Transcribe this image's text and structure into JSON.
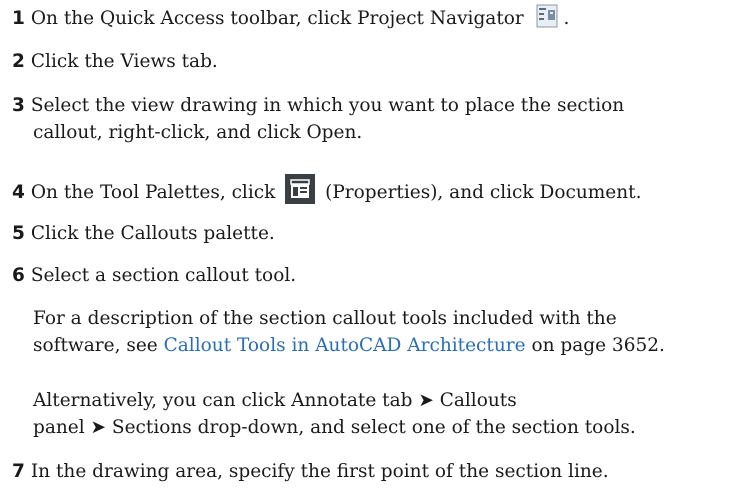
{
  "steps": [
    {
      "num": "1",
      "text_before": "On the Quick Access toolbar, click Project Navigator",
      "text_after": "."
    },
    {
      "num": "2",
      "text": "Click the Views tab."
    },
    {
      "num": "3",
      "line1": "Select the view drawing in which you want to place the section",
      "line2": "callout, right-click, and click Open."
    },
    {
      "num": "4",
      "text_before": "On the Tool Palettes, click",
      "text_after": "(Properties), and click Document."
    },
    {
      "num": "5",
      "text": "Click the Callouts palette."
    },
    {
      "num": "6",
      "text": "Select a section callout tool."
    },
    {
      "num": "7",
      "text": "In the drawing area, specify the first point of the section line."
    }
  ],
  "note1": {
    "line1": "For a description of the section callout tools included with the",
    "line2_link": "software, see",
    "link_text": "Callout Tools in AutoCAD Architecture",
    "line2_after": "on page 3652."
  },
  "note2": {
    "line1": "Alternatively, you can click Annotate tab ➤ Callouts",
    "line2": "panel ➤ Sections drop-down, and select one of the section tools."
  },
  "icons": {
    "project_navigator": "project-navigator-icon",
    "properties": "properties-icon"
  },
  "colors": {
    "text": "#1a1a1a",
    "link": "#2a6db5"
  }
}
